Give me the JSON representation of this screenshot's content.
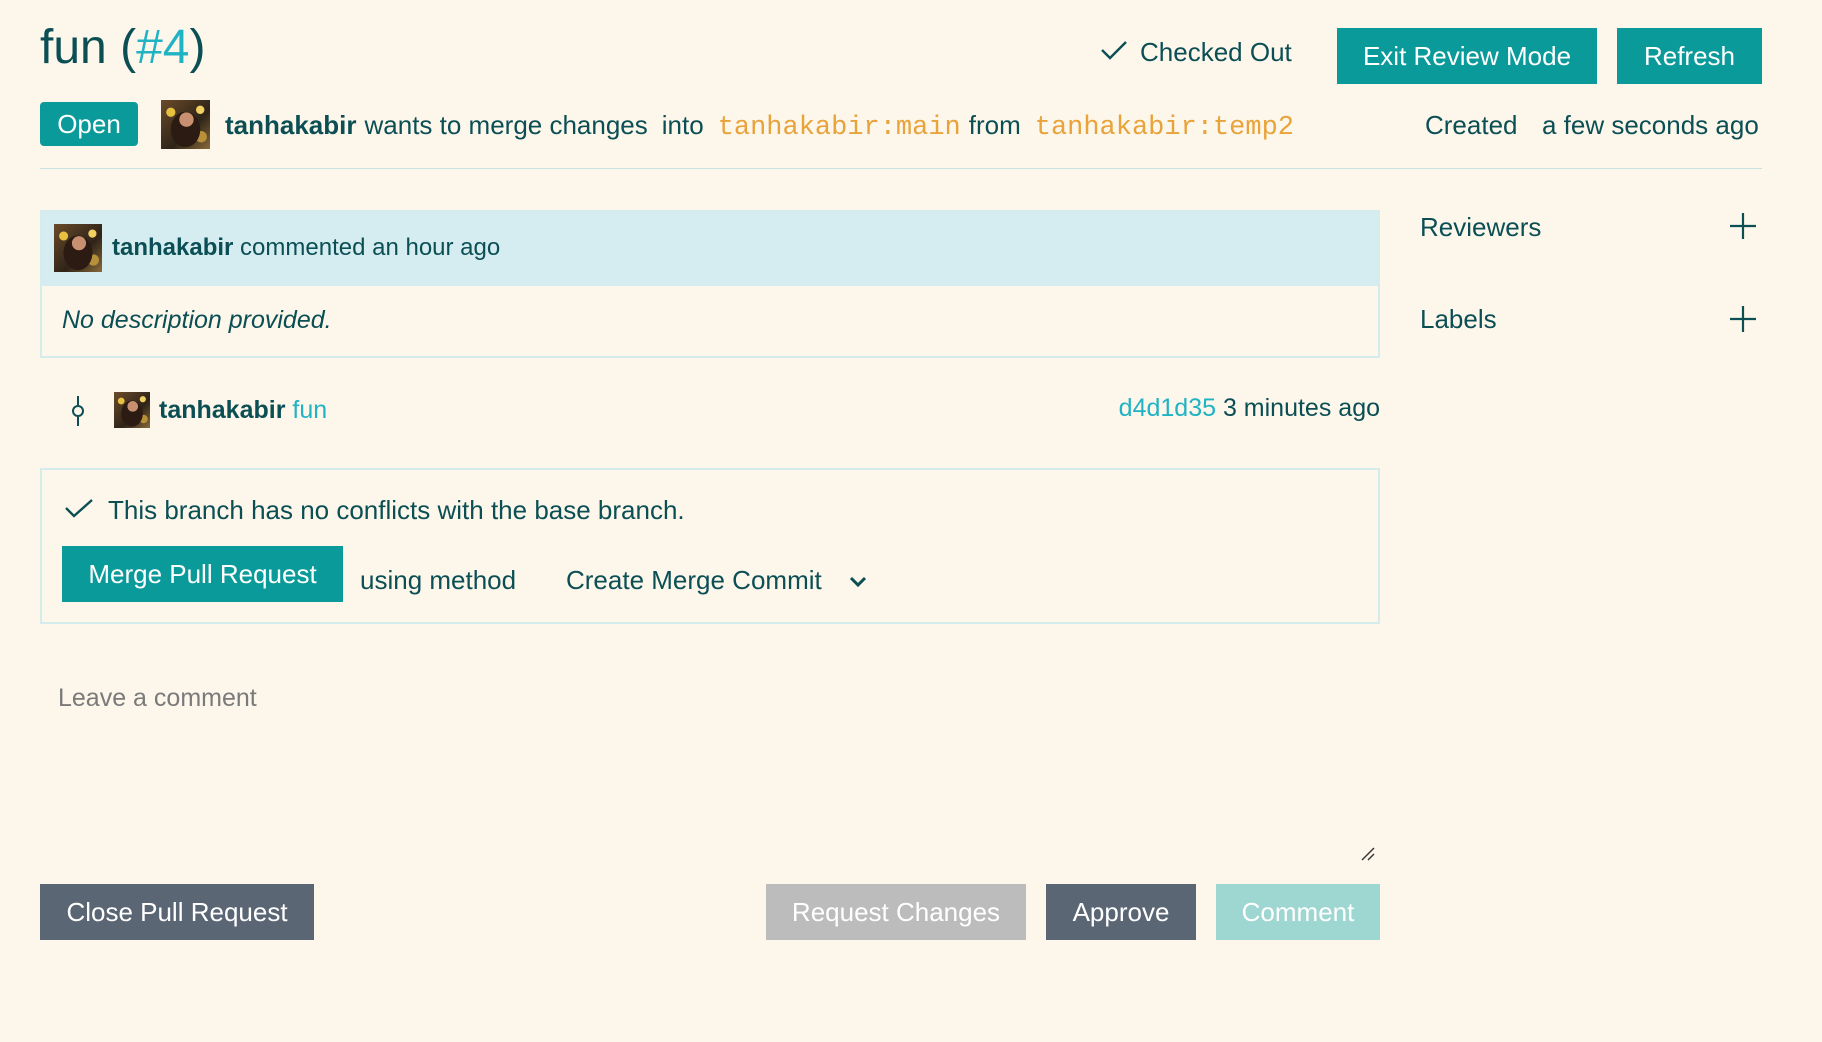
{
  "header": {
    "title": "fun",
    "number": "#4",
    "checked_out_label": "Checked Out",
    "exit_review_label": "Exit Review Mode",
    "refresh_label": "Refresh"
  },
  "status": {
    "state": "Open",
    "author": "tanhakabir",
    "wants_text": "wants to merge changes",
    "into_text": "into",
    "target_branch": "tanhakabir:main",
    "from_text": "from",
    "source_branch": "tanhakabir:temp2",
    "created_label": "Created",
    "created_time": "a few seconds ago"
  },
  "description": {
    "author": "tanhakabir",
    "action": "commented an hour ago",
    "body": "No description provided."
  },
  "commit": {
    "author": "tanhakabir",
    "message": "fun",
    "sha": "d4d1d35",
    "time": "3 minutes ago"
  },
  "merge": {
    "status_text": "This branch has no conflicts with the base branch.",
    "merge_button_label": "Merge Pull Request",
    "using_method_text": "using method",
    "selected_method": "Create Merge Commit"
  },
  "comment_box": {
    "placeholder": "Leave a comment"
  },
  "actions": {
    "close_label": "Close Pull Request",
    "request_changes_label": "Request Changes",
    "approve_label": "Approve",
    "comment_label": "Comment"
  },
  "sidebar": {
    "reviewers_label": "Reviewers",
    "labels_label": "Labels"
  },
  "colors": {
    "background": "#fdf6ea",
    "primary_teal": "#0b9a9a",
    "text_dark_teal": "#0b4f55",
    "link_cyan": "#1fb3c4",
    "branch_orange": "#e8a33a",
    "slate_button": "#5b6675"
  }
}
